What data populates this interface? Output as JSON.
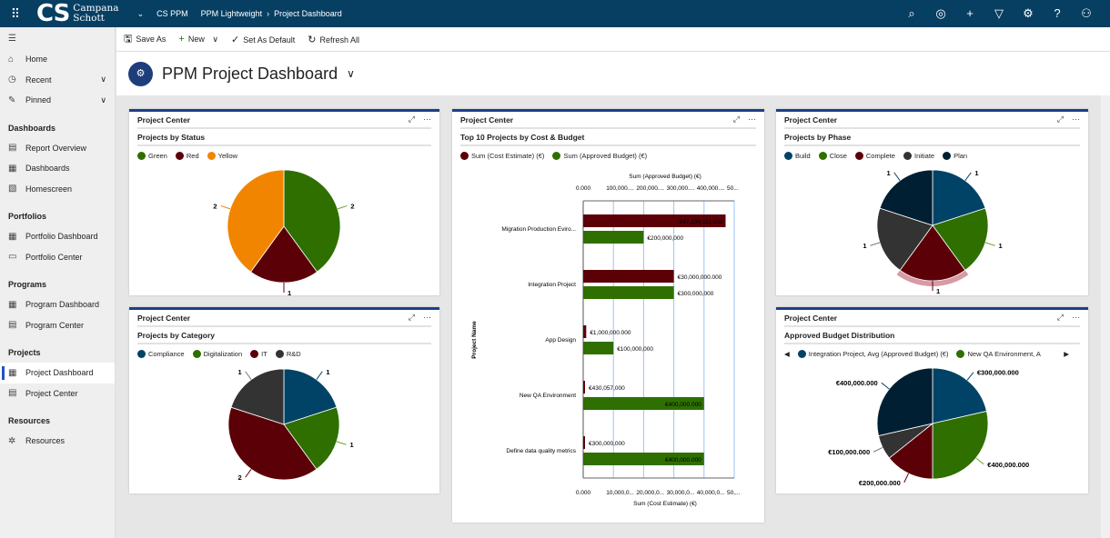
{
  "topbar": {
    "logo_mark": "CS",
    "logo_name_1": "Campana",
    "logo_name_2": "Schott",
    "app": "CS PPM",
    "breadcrumb": [
      "PPM Lightweight",
      "Project Dashboard"
    ],
    "icons": [
      "search-icon",
      "lightbulb-icon",
      "plus-icon",
      "filter-icon",
      "gear-icon",
      "help-icon",
      "user-icon"
    ]
  },
  "sidebar": {
    "top": [
      {
        "label": "Home",
        "icon": "home-icon"
      },
      {
        "label": "Recent",
        "icon": "clock-icon"
      },
      {
        "label": "Pinned",
        "icon": "pin-icon"
      }
    ],
    "groups": [
      {
        "title": "Dashboards",
        "items": [
          "Report Overview",
          "Dashboards",
          "Homescreen"
        ]
      },
      {
        "title": "Portfolios",
        "items": [
          "Portfolio Dashboard",
          "Portfolio Center"
        ]
      },
      {
        "title": "Programs",
        "items": [
          "Program Dashboard",
          "Program Center"
        ]
      },
      {
        "title": "Projects",
        "items": [
          "Project Dashboard",
          "Project Center"
        ]
      },
      {
        "title": "Resources",
        "items": [
          "Resources"
        ]
      }
    ],
    "active": "Project Dashboard"
  },
  "commands": {
    "save_as": "Save As",
    "new": "New",
    "set_default": "Set As Default",
    "refresh": "Refresh All"
  },
  "page_title": "PPM Project Dashboard",
  "cards": {
    "status": {
      "header": "Project Center",
      "title": "Projects by Status"
    },
    "category": {
      "header": "Project Center",
      "title": "Projects by Category"
    },
    "bars": {
      "header": "Project Center",
      "title": "Top 10 Projects by Cost & Budget"
    },
    "phase": {
      "header": "Project Center",
      "title": "Projects by Phase"
    },
    "budget": {
      "header": "Project Center",
      "title": "Approved Budget Distribution"
    }
  },
  "chart_data": [
    {
      "type": "pie",
      "id": "status",
      "title": "Projects by Status",
      "categories": [
        "Green",
        "Red",
        "Yellow"
      ],
      "values": [
        2,
        1,
        2
      ],
      "labels": [
        "2",
        "1",
        "2"
      ],
      "colors": [
        "#2e6f00",
        "#5c0008",
        "#f28500"
      ]
    },
    {
      "type": "pie",
      "id": "category",
      "title": "Projects by Category",
      "categories": [
        "Compliance",
        "Digitalization",
        "IT",
        "R&D"
      ],
      "values": [
        1,
        1,
        2,
        1
      ],
      "labels": [
        "1",
        "1",
        "2",
        "1"
      ],
      "colors": [
        "#004366",
        "#2e6f00",
        "#5c0008",
        "#333333"
      ]
    },
    {
      "type": "bar",
      "id": "bars",
      "orientation": "horizontal",
      "title": "Top 10 Projects by Cost & Budget",
      "ylabel": "Project Name",
      "categories": [
        "Migration Production Eviro...",
        "Integration Project",
        "App Design",
        "New QA Environment",
        "Define data quality metrics"
      ],
      "series": [
        {
          "name": "Sum (Cost Estimate) (€)",
          "color": "#5c0008",
          "axis": "bottom",
          "values": [
            47134111000,
            30000000000,
            1000000000,
            430057000,
            300000000
          ],
          "labels": [
            "€47,134,111.000",
            "€30,000,000.000",
            "€1,000,000.000",
            "€430,057,000",
            "€300,000,000"
          ]
        },
        {
          "name": "Sum (Approved Budget) (€)",
          "color": "#2e6f00",
          "axis": "top",
          "values": [
            200000000,
            300000000,
            100000000,
            400000000,
            400000000
          ],
          "labels": [
            "€200,000,000",
            "€300,000,000",
            "€100,000,000",
            "€400,000.000",
            "€400,000.000"
          ]
        }
      ],
      "top_axis": {
        "label": "Sum (Approved Budget) (€)",
        "range": [
          0,
          500000000
        ],
        "ticks": [
          "0.000",
          "100,000....",
          "200,000....",
          "300,000....",
          "400,000....",
          "50..."
        ]
      },
      "bottom_axis": {
        "label": "Sum (Cost Estimate) (€)",
        "range": [
          0,
          50000000000
        ],
        "ticks": [
          "0.000",
          "10,000,0...",
          "20,000,0...",
          "30,000,0...",
          "40,000,0...",
          "50,..."
        ]
      },
      "grid": true
    },
    {
      "type": "pie",
      "id": "phase",
      "title": "Projects by Phase",
      "categories": [
        "Build",
        "Close",
        "Complete",
        "Initiate",
        "Plan"
      ],
      "values": [
        1,
        1,
        1,
        1,
        1
      ],
      "labels": [
        "1",
        "1",
        "1",
        "1",
        "1"
      ],
      "colors": [
        "#004366",
        "#2e6f00",
        "#5c0008",
        "#333333",
        "#001f33"
      ],
      "highlighted": "Complete"
    },
    {
      "type": "pie",
      "id": "budget",
      "title": "Approved Budget Distribution",
      "legend": [
        "Integration Project, Avg (Approved Budget) (€)",
        "New QA Environment, A"
      ],
      "values": [
        300000000,
        400000000,
        200000000,
        100000000,
        400000000
      ],
      "labels": [
        "€300,000.000",
        "€400,000.000",
        "€200,000.000",
        "€100,000.000",
        "€400,000.000"
      ],
      "colors": [
        "#004366",
        "#2e6f00",
        "#5c0008",
        "#333333",
        "#001f33"
      ]
    }
  ]
}
